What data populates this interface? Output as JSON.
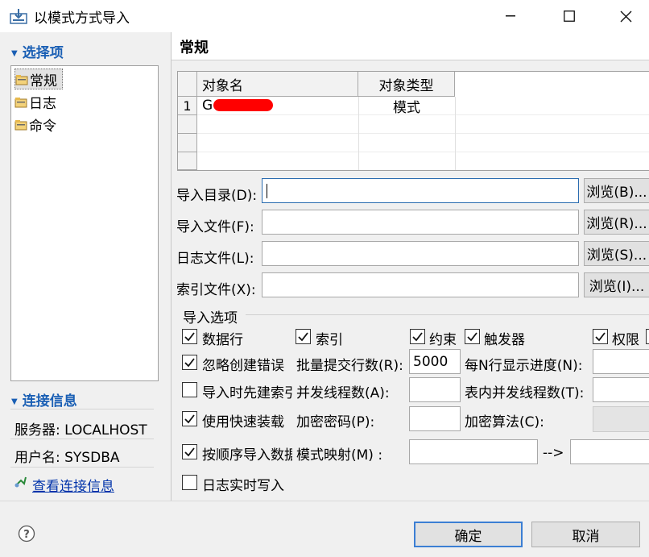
{
  "window": {
    "title": "以模式方式导入",
    "min_icon": "minimize-icon",
    "max_icon": "maximize-icon",
    "close_icon": "close-icon"
  },
  "left": {
    "select_header": "选择项",
    "items": [
      {
        "label": "常规",
        "selected": true
      },
      {
        "label": "日志",
        "selected": false
      },
      {
        "label": "命令",
        "selected": false
      }
    ],
    "conn_header": "连接信息",
    "server": "服务器: LOCALHOST",
    "user": "用户名: SYSDBA",
    "view_conn": "查看连接信息"
  },
  "right": {
    "title": "常规",
    "table": {
      "headers": [
        "对象名",
        "对象类型"
      ],
      "rows": [
        {
          "num": "1",
          "name": "G",
          "type": "模式"
        },
        {
          "num": "",
          "name": "",
          "type": ""
        },
        {
          "num": "",
          "name": "",
          "type": ""
        },
        {
          "num": "",
          "name": "",
          "type": ""
        }
      ]
    },
    "dir_label": "导入目录(D):",
    "dir_value": "",
    "dir_browse": "浏览(B)...",
    "file_label": "导入文件(F):",
    "file_value": "",
    "file_browse": "浏览(R)...",
    "log_label": "日志文件(L):",
    "log_value": "",
    "log_browse": "浏览(S)...",
    "index_label": "索引文件(X):",
    "index_value": "",
    "index_browse": "浏览(I)...",
    "options_title": "导入选项",
    "opt_rows": "数据行",
    "opt_index": "索引",
    "opt_constraint": "约束",
    "opt_trigger": "触发器",
    "opt_privilege": "权限",
    "opt_ignore": "忽略创建错误",
    "opt_prebuild": "导入时先建索引",
    "opt_fastload": "使用快速装载",
    "opt_order": "按顺序导入数据",
    "opt_realtime": "日志实时写入",
    "batch_label": "批量提交行数(R):",
    "batch_value": "5000",
    "progress_label": "每N行显示进度(N):",
    "parallel_label": "并发线程数(A):",
    "table_parallel_label": "表内并发线程数(T):",
    "encrypt_pwd_label": "加密密码(P):",
    "encrypt_alg_label": "加密算法(C):",
    "schema_map_label": "模式映射(M) :",
    "arrow": "-->"
  },
  "footer": {
    "help_icon": "help-icon",
    "ok": "确定",
    "cancel": "取消"
  },
  "colors": {
    "accent": "#1a5fb4",
    "primary_border": "#3c7fd4",
    "redaction": "#ff0000"
  }
}
